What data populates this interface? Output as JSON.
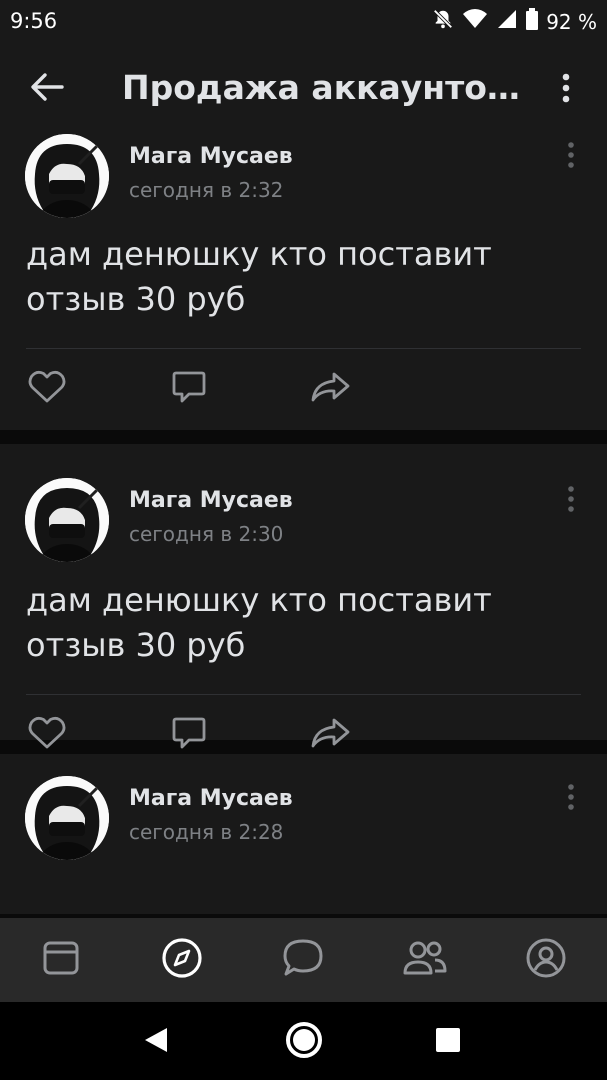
{
  "status_bar": {
    "time": "9:56",
    "battery": "92 %",
    "icons": [
      "mute-bell-icon",
      "wifi-icon",
      "signal-icon",
      "battery-icon"
    ]
  },
  "header": {
    "title": "Продажа аккаунтов...",
    "back_icon": "back-arrow-icon",
    "more_icon": "more-vertical-icon"
  },
  "posts": [
    {
      "author": "Мага Мусаев",
      "time": "сегодня в 2:32",
      "text": "дам денюшку кто поставит отзыв 30 руб"
    },
    {
      "author": "Мага Мусаев",
      "time": "сегодня в 2:30",
      "text": "дам денюшку кто поставит отзыв 30 руб"
    },
    {
      "author": "Мага Мусаев",
      "time": "сегодня в 2:28",
      "text": ""
    }
  ],
  "bottom_nav": {
    "items": [
      "feed-icon",
      "discover-icon",
      "messages-icon",
      "friends-icon",
      "profile-icon"
    ],
    "active_item": "discover-icon"
  },
  "system_nav": [
    "back-triangle-icon",
    "home-circle-icon",
    "recents-square-icon"
  ],
  "colors": {
    "background": "#0a0a0a",
    "surface": "#191919",
    "nav_surface": "#292929",
    "text_primary": "#e1e3e6",
    "text_secondary": "#7e8185",
    "icon": "#939599"
  }
}
